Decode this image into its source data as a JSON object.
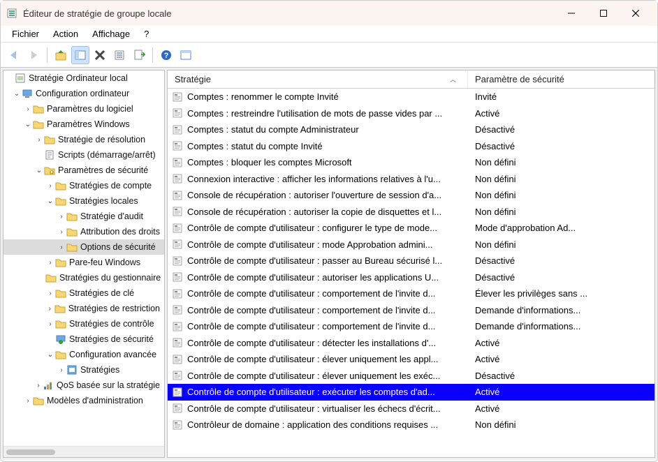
{
  "window": {
    "title": "Éditeur de stratégie de groupe locale"
  },
  "menu": {
    "items": [
      "Fichier",
      "Action",
      "Affichage",
      "?"
    ]
  },
  "tree": {
    "root": "Stratégie Ordinateur local",
    "config": "Configuration ordinateur",
    "paramLog": "Paramètres du logiciel",
    "paramWin": "Paramètres Windows",
    "stratResol": "Stratégie de résolution",
    "scripts": "Scripts (démarrage/arrêt)",
    "paramSecu": "Paramètres de sécurité",
    "stratDe1": "Stratégies de compte",
    "stratLoc": "Stratégies locales",
    "stratAudit": "Stratégie d'audit",
    "attribution": "Attribution des droits",
    "optionsSecu": "Options de sécurité",
    "parefeu": "Pare-feu Windows",
    "stratDu": "Stratégies du gestionnaire",
    "stratDe2": "Stratégies de clé",
    "stratDe3": "Stratégies de restriction",
    "stratDe4": "Stratégies de contrôle",
    "stratDe5": "Stratégies de sécurité",
    "configuration": "Configuration avancée",
    "stratDeSub": "Stratégies",
    "qos": "QoS basée sur la stratégie",
    "modeles": "Modèles d'administration"
  },
  "columns": {
    "strategy": "Stratégie",
    "param": "Paramètre de sécurité"
  },
  "rows": [
    {
      "s": "Comptes : renommer le compte Invité",
      "p": "Invité"
    },
    {
      "s": "Comptes : restreindre l'utilisation de mots de passe vides par ...",
      "p": "Activé"
    },
    {
      "s": "Comptes : statut du compte Administrateur",
      "p": "Désactivé"
    },
    {
      "s": "Comptes : statut du compte Invité",
      "p": "Désactivé"
    },
    {
      "s": "Comptes : bloquer les comptes Microsoft",
      "p": "Non défini"
    },
    {
      "s": "Connexion interactive : afficher les informations relatives à l'u...",
      "p": "Non défini"
    },
    {
      "s": "Console de récupération : autoriser l'ouverture de session d'a...",
      "p": "Non défini"
    },
    {
      "s": "Console de récupération : autoriser la copie de disquettes et l...",
      "p": "Non défini"
    },
    {
      "s": "Contrôle de compte d'utilisateur : configurer le type de mode...",
      "p": "Mode d'approbation Ad..."
    },
    {
      "s": "Contrôle de compte d'utilisateur : mode Approbation admini...",
      "p": "Non défini"
    },
    {
      "s": "Contrôle de compte d'utilisateur : passer au Bureau sécurisé l...",
      "p": "Désactivé"
    },
    {
      "s": "Contrôle de compte d'utilisateur : autoriser les applications U...",
      "p": "Désactivé"
    },
    {
      "s": "Contrôle de compte d'utilisateur : comportement de l'invite d...",
      "p": "Élever les privilèges sans ..."
    },
    {
      "s": "Contrôle de compte d'utilisateur : comportement de l'invite d...",
      "p": "Demande d'informations..."
    },
    {
      "s": "Contrôle de compte d'utilisateur : comportement de l'invite d...",
      "p": "Demande d'informations..."
    },
    {
      "s": "Contrôle de compte d'utilisateur : détecter les installations d'...",
      "p": "Activé"
    },
    {
      "s": "Contrôle de compte d'utilisateur : élever uniquement les appl...",
      "p": "Activé"
    },
    {
      "s": "Contrôle de compte d'utilisateur : élever uniquement les exéc...",
      "p": "Désactivé"
    },
    {
      "s": "Contrôle de compte d'utilisateur : exécuter les comptes d'ad...",
      "p": "Activé",
      "selected": true
    },
    {
      "s": "Contrôle de compte d'utilisateur : virtualiser les échecs d'écrit...",
      "p": "Activé"
    },
    {
      "s": "Contrôleur de domaine : application des conditions requises ...",
      "p": "Non défini"
    }
  ]
}
